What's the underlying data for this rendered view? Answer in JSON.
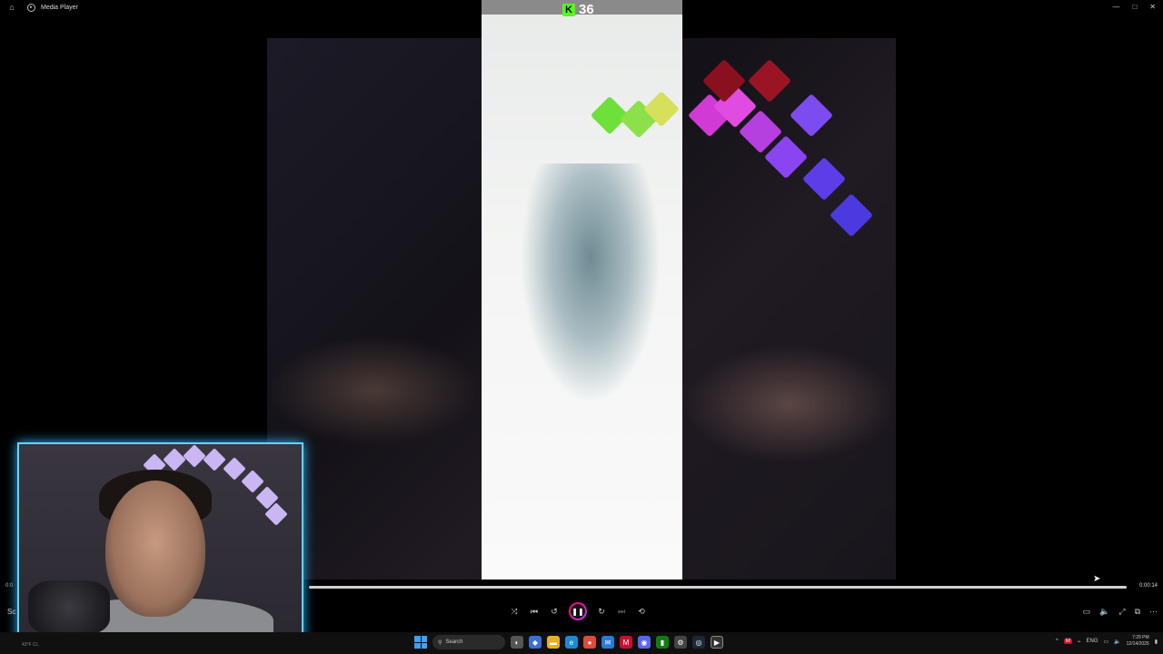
{
  "window": {
    "title": "Media Player",
    "home_glyph": "⌂",
    "app_glyph": "▸",
    "minimize": "—",
    "maximize": "□",
    "close": "✕"
  },
  "overlay": {
    "kick_logo": "K",
    "kick_count": "36"
  },
  "player": {
    "time_elapsed": "0:0",
    "time_total": "0:00:14",
    "left_label": "Sc",
    "progress_fraction": 1.0,
    "shuffle": "⤨",
    "previous": "⏮",
    "rewind": "↺",
    "play_pause": "❚❚",
    "forward": "↻",
    "next": "⏭",
    "repeat": "⟲",
    "subtitles": "▭",
    "volume": "🔈",
    "fullscreen": "⤢",
    "miniplayer": "⧉",
    "more": "⋯"
  },
  "taskbar": {
    "weather": "43°F Cl..",
    "search_placeholder": "Search",
    "search_icon": "search-icon",
    "apps": [
      "folder",
      "edge",
      "chrome",
      "mail",
      "mcafee",
      "discord",
      "xbox",
      "settings",
      "steam",
      "media-player"
    ],
    "tray_language": "ENG",
    "time": "7:29 PM",
    "date": "12/14/2025",
    "chevron": "^"
  },
  "colors": {
    "accent": "#53fc18",
    "webcam_border": "#5fd6ff",
    "play_gradient_start": "#ff0066",
    "play_gradient_end": "#cc33ff"
  }
}
